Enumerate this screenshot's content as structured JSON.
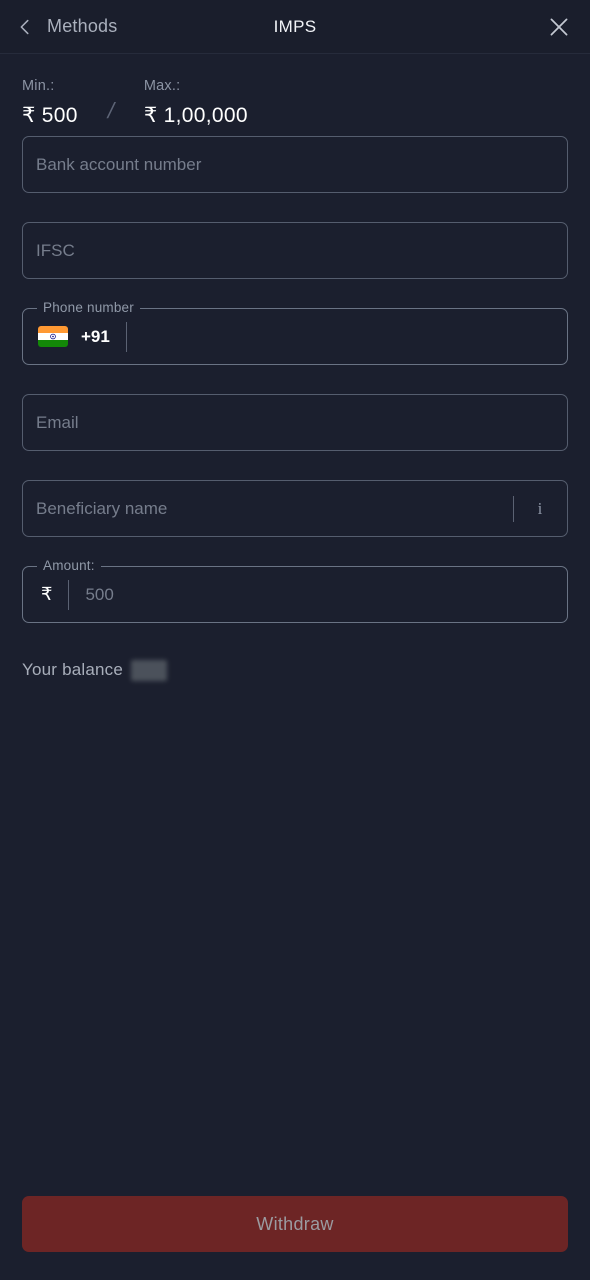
{
  "header": {
    "back_label": "Methods",
    "title": "IMPS",
    "back_icon": "chevron-left-icon",
    "close_icon": "close-icon"
  },
  "limits": {
    "min_label": "Min.:",
    "min_value": "₹ 500",
    "separator": "/",
    "max_label": "Max.:",
    "max_value": "₹ 1,00,000"
  },
  "form": {
    "bank_account": {
      "placeholder": "Bank account number",
      "value": ""
    },
    "ifsc": {
      "placeholder": "IFSC",
      "value": ""
    },
    "phone": {
      "legend": "Phone number",
      "flag_icon": "india-flag-icon",
      "dial_code": "+91",
      "placeholder": "",
      "value": ""
    },
    "email": {
      "placeholder": "Email",
      "value": ""
    },
    "beneficiary": {
      "placeholder": "Beneficiary name",
      "value": "",
      "info_icon": "info-icon",
      "info_glyph": "i"
    },
    "amount": {
      "legend": "Amount:",
      "currency_symbol": "₹",
      "placeholder": "500",
      "value": ""
    }
  },
  "balance": {
    "label": "Your balance",
    "value_hidden": true
  },
  "footer": {
    "withdraw_label": "Withdraw"
  },
  "colors": {
    "background": "#1b1f2e",
    "header_background": "#1a1e2c",
    "field_border": "#555d6e",
    "placeholder": "#767d8c",
    "primary_text": "#ffffff",
    "muted_text": "#8b93a3",
    "withdraw_button": "#6d2525",
    "withdraw_label": "#9b9ba0"
  }
}
